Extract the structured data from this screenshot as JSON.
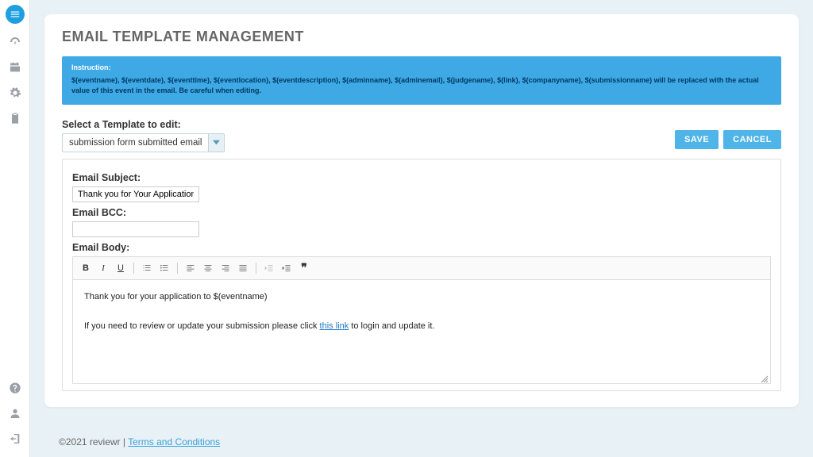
{
  "page": {
    "title": "EMAIL TEMPLATE MANAGEMENT"
  },
  "instructions": {
    "title": "Instruction:",
    "body": "$(eventname), $(eventdate), $(eventtime), $(eventlocation), $(eventdescription), $(adminname), $(adminemail), $(judgename), $(link), $(companyname), $(submissionname) will be replaced with the actual value of this event in the email. Be careful when editing."
  },
  "template_select": {
    "label": "Select a Template to edit:",
    "value": "submission form submitted email"
  },
  "buttons": {
    "save": "SAVE",
    "cancel": "CANCEL"
  },
  "form": {
    "subject_label": "Email Subject:",
    "subject_value": "Thank you for Your Application to $(",
    "bcc_label": "Email BCC:",
    "bcc_value": "",
    "body_label": "Email Body:"
  },
  "editor": {
    "line1": "Thank you for your application to $(eventname)",
    "line2_pre": "If you need to review or update your submission please click ",
    "line2_link": "this link",
    "line2_post": " to login and update it."
  },
  "footer": {
    "copyright": "©2021 reviewr | ",
    "terms": "Terms and Conditions"
  }
}
